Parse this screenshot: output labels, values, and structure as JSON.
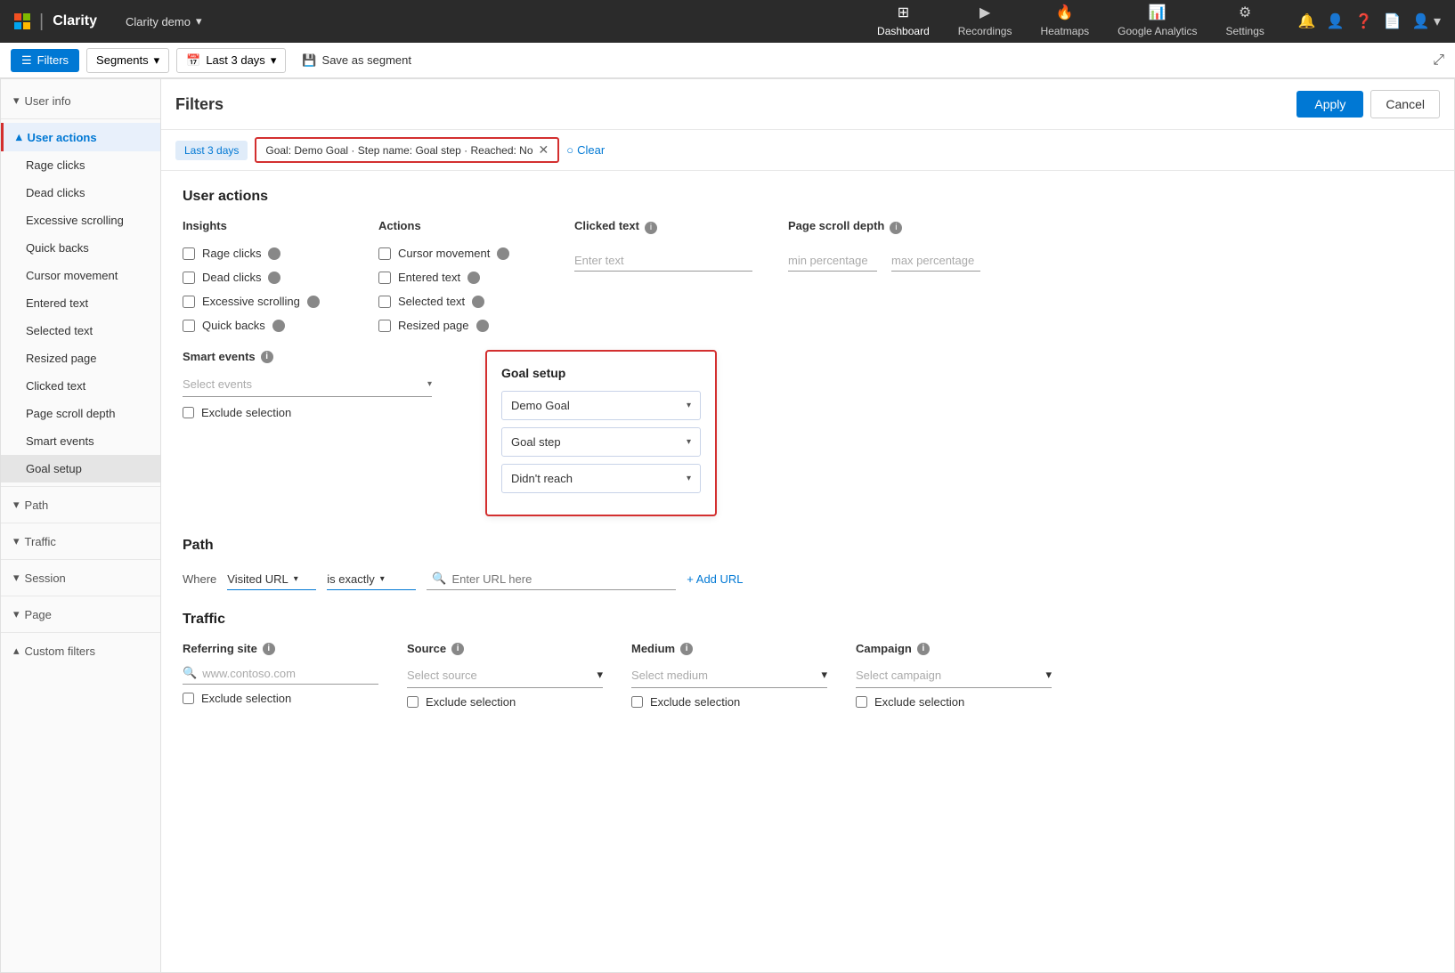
{
  "topNav": {
    "brandName": "Clarity",
    "projectName": "Clarity demo",
    "navLinks": [
      {
        "id": "dashboard",
        "label": "Dashboard",
        "icon": "⊞",
        "active": true
      },
      {
        "id": "recordings",
        "label": "Recordings",
        "icon": "🎬",
        "active": false
      },
      {
        "id": "heatmaps",
        "label": "Heatmaps",
        "icon": "🔥",
        "active": false
      },
      {
        "id": "google-analytics",
        "label": "Google Analytics",
        "icon": "📊",
        "active": false
      },
      {
        "id": "settings",
        "label": "Settings",
        "icon": "⚙",
        "active": false
      }
    ],
    "actionIcons": [
      "🔔",
      "👤",
      "❓",
      "📄",
      "👤"
    ]
  },
  "secondaryBar": {
    "filtersLabel": "Filters",
    "segmentsLabel": "Segments",
    "last3daysLabel": "Last 3 days",
    "saveAsSegmentLabel": "Save as segment"
  },
  "filtersPanel": {
    "title": "Filters",
    "applyLabel": "Apply",
    "cancelLabel": "Cancel",
    "activeFilters": {
      "timeChip": "Last 3 days",
      "goalChip": "Goal: Demo Goal · Step name: Goal step · Reached: No",
      "clearLabel": "Clear"
    },
    "sidebar": {
      "sections": [
        {
          "id": "user-info",
          "label": "User info",
          "expanded": false,
          "active": false
        },
        {
          "id": "user-actions",
          "label": "User actions",
          "expanded": true,
          "active": true,
          "items": [
            {
              "id": "rage-clicks",
              "label": "Rage clicks",
              "active": false
            },
            {
              "id": "dead-clicks",
              "label": "Dead clicks",
              "active": false
            },
            {
              "id": "excessive-scrolling",
              "label": "Excessive scrolling",
              "active": false
            },
            {
              "id": "quick-backs",
              "label": "Quick backs",
              "active": false
            },
            {
              "id": "cursor-movement",
              "label": "Cursor movement",
              "active": false
            },
            {
              "id": "entered-text",
              "label": "Entered text",
              "active": false
            },
            {
              "id": "selected-text",
              "label": "Selected text",
              "active": false
            },
            {
              "id": "resized-page",
              "label": "Resized page",
              "active": false
            },
            {
              "id": "clicked-text",
              "label": "Clicked text",
              "active": false
            },
            {
              "id": "page-scroll-depth",
              "label": "Page scroll depth",
              "active": false
            },
            {
              "id": "smart-events",
              "label": "Smart events",
              "active": false
            },
            {
              "id": "goal-setup",
              "label": "Goal setup",
              "active": true
            }
          ]
        },
        {
          "id": "path",
          "label": "Path",
          "expanded": false,
          "active": false
        },
        {
          "id": "traffic",
          "label": "Traffic",
          "expanded": false,
          "active": false
        },
        {
          "id": "session",
          "label": "Session",
          "expanded": false,
          "active": false
        },
        {
          "id": "page",
          "label": "Page",
          "expanded": false,
          "active": false
        },
        {
          "id": "custom-filters",
          "label": "Custom filters",
          "expanded": true,
          "active": false
        }
      ]
    },
    "userActionsSection": {
      "title": "User actions",
      "insights": {
        "header": "Insights",
        "items": [
          {
            "label": "Rage clicks",
            "checked": false
          },
          {
            "label": "Dead clicks",
            "checked": false
          },
          {
            "label": "Excessive scrolling",
            "checked": false
          },
          {
            "label": "Quick backs",
            "checked": false
          }
        ]
      },
      "actions": {
        "header": "Actions",
        "items": [
          {
            "label": "Cursor movement",
            "checked": false
          },
          {
            "label": "Entered text",
            "checked": false
          },
          {
            "label": "Selected text",
            "checked": false
          },
          {
            "label": "Resized page",
            "checked": false
          }
        ]
      },
      "clickedText": {
        "header": "Clicked text",
        "placeholder": "Enter text"
      },
      "pageScrollDepth": {
        "header": "Page scroll depth",
        "minPlaceholder": "min percentage",
        "maxPlaceholder": "max percentage"
      }
    },
    "smartEvents": {
      "header": "Smart events",
      "selectPlaceholder": "Select events",
      "excludeLabel": "Exclude selection"
    },
    "goalSetup": {
      "title": "Goal setup",
      "goalDropdown": "Demo Goal",
      "stepDropdown": "Goal step",
      "reachedDropdown": "Didn't reach"
    },
    "pathSection": {
      "title": "Path",
      "whereLabel": "Where",
      "visitedUrlLabel": "Visited URL",
      "isExactlyLabel": "is exactly",
      "urlPlaceholder": "Enter URL here",
      "addUrlLabel": "+ Add URL"
    },
    "trafficSection": {
      "title": "Traffic",
      "referringSite": {
        "header": "Referring site",
        "placeholder": "www.contoso.com",
        "excludeLabel": "Exclude selection"
      },
      "source": {
        "header": "Source",
        "selectPlaceholder": "Select source",
        "excludeLabel": "Exclude selection"
      },
      "medium": {
        "header": "Medium",
        "selectPlaceholder": "Select medium",
        "excludeLabel": "Exclude selection"
      },
      "campaign": {
        "header": "Campaign",
        "selectPlaceholder": "Select campaign",
        "excludeLabel": "Exclude selection"
      }
    }
  }
}
